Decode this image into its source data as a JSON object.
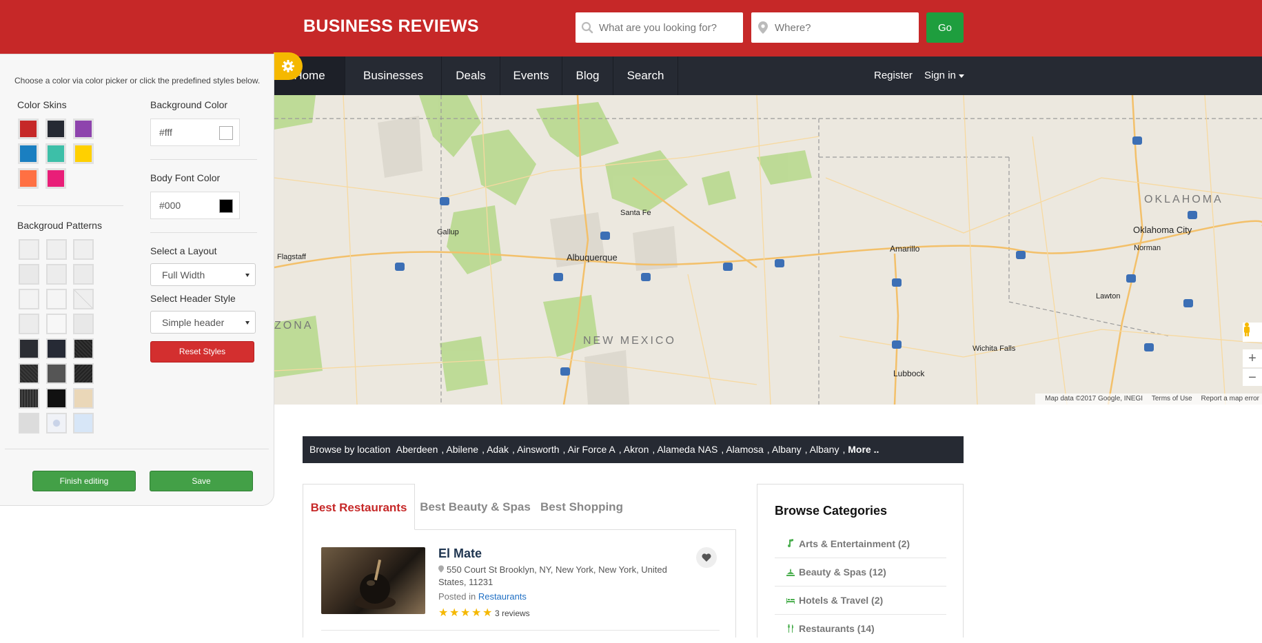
{
  "header": {
    "logo": "BUSINESS REVIEWS",
    "search_placeholder": "What are you looking for?",
    "where_placeholder": "Where?",
    "go_label": "Go"
  },
  "nav": {
    "items": [
      {
        "label": "Home",
        "active": true
      },
      {
        "label": "Businesses"
      },
      {
        "label": "Deals"
      },
      {
        "label": "Events"
      },
      {
        "label": "Blog"
      },
      {
        "label": "Search"
      }
    ],
    "register": "Register",
    "signin": "Sign in"
  },
  "map": {
    "states": [
      "NEW MEXICO",
      "OKLAHOMA",
      "ZONA"
    ],
    "cities": [
      "Albuquerque",
      "Santa Fe",
      "Amarillo",
      "Oklahoma City",
      "Lubbock",
      "Flagstaff",
      "Gallup",
      "Norman",
      "Lawton",
      "Wichita Falls"
    ],
    "footer": {
      "data": "Map data ©2017 Google, INEGI",
      "terms": "Terms of Use",
      "report": "Report a map error"
    }
  },
  "style_panel": {
    "hint": "Choose a color via color picker or click the predefined styles below.",
    "color_skins_label": "Color Skins",
    "patterns_label": "Backgroud Patterns",
    "bg_color_label": "Background Color",
    "bg_color_value": "#fff",
    "font_color_label": "Body Font Color",
    "font_color_value": "#000",
    "layout_label": "Select a Layout",
    "layout_value": "Full Width",
    "header_style_label": "Select Header Style",
    "header_style_value": "Simple header",
    "reset_label": "Reset Styles",
    "finish_label": "Finish editing",
    "save_label": "Save",
    "skins": [
      "#c62828",
      "#262a33",
      "#8e44ad",
      "#1a7fc1",
      "#3dbfa8",
      "#ffd000",
      "#ff7043",
      "#e91e78"
    ]
  },
  "locations": {
    "prefix": "Browse by location",
    "items": [
      "Aberdeen",
      "Abilene",
      "Adak",
      "Ainsworth",
      "Air Force A",
      "Akron",
      "Alameda NAS",
      "Alamosa",
      "Albany",
      "Albany"
    ],
    "more": "More .."
  },
  "tabs": [
    "Best Restaurants",
    "Best Beauty & Spas",
    "Best Shopping"
  ],
  "listing": {
    "title": "El Mate",
    "address": "550 Court St Brooklyn, NY, New York, New York, United States, 11231",
    "posted_in": "Posted in",
    "category": "Restaurants",
    "rating": 5,
    "reviews": "3 reviews"
  },
  "categories": {
    "title": "Browse Categories",
    "items": [
      {
        "label": "Arts & Entertainment (2)",
        "icon": "music-note-icon"
      },
      {
        "label": "Beauty & Spas (12)",
        "icon": "spa-icon"
      },
      {
        "label": "Hotels & Travel (2)",
        "icon": "bed-icon"
      },
      {
        "label": "Restaurants (14)",
        "icon": "fork-knife-icon"
      }
    ]
  },
  "colors": {
    "brand_red": "#c62828",
    "nav_dark": "#262a33",
    "go_green": "#1e9e3e",
    "gear_yellow": "#f5b800"
  }
}
